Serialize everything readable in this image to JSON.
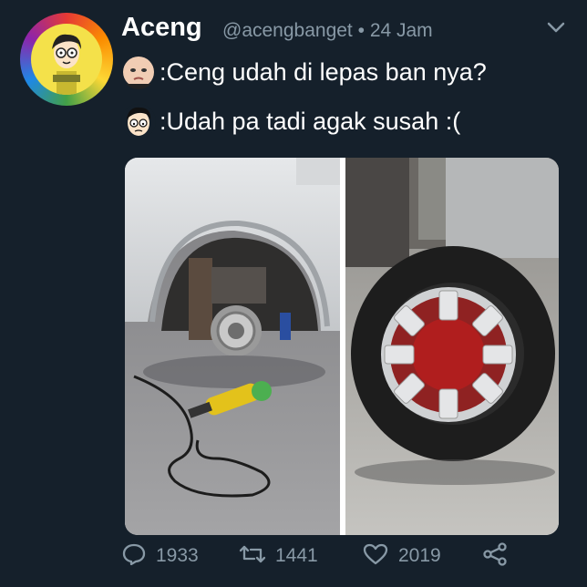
{
  "tweet": {
    "display_name": "Aceng",
    "handle": "@acengbanget",
    "separator": "•",
    "time": "24 Jam",
    "lines": [
      {
        "emoji": "baby-face-icon",
        "text": ":Ceng udah di lepas ban nya?"
      },
      {
        "emoji": "cartoon-boy-icon",
        "text": ":Udah pa tadi agak susah :("
      }
    ]
  },
  "actions": {
    "replies": "1933",
    "retweets": "1441",
    "likes": "2019"
  },
  "icons": {
    "reply": "comment-icon",
    "retweet": "retweet-icon",
    "like": "heart-icon",
    "share": "share-icon",
    "menu": "chevron-down-icon"
  },
  "colors": {
    "background": "#15202b",
    "muted_text": "#8899a6",
    "primary_text": "#ffffff"
  }
}
